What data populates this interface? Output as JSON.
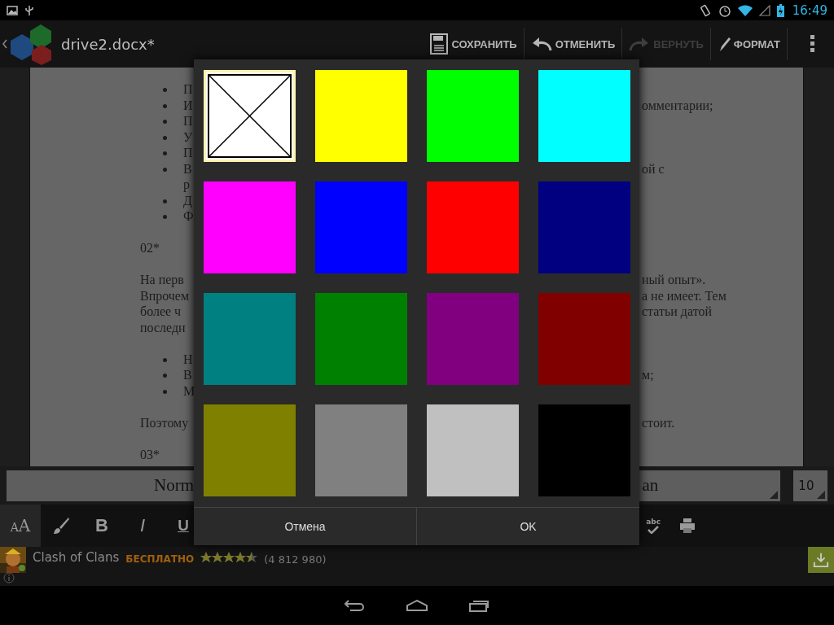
{
  "status_bar": {
    "time": "16:49"
  },
  "action_bar": {
    "title": "drive2.docx*",
    "actions": [
      {
        "kind": "save",
        "label": "СОХРАНИТЬ",
        "disabled": false
      },
      {
        "kind": "undo",
        "label": "ОТМЕНИТЬ",
        "disabled": false
      },
      {
        "kind": "redo",
        "label": "ВЕРНУТЬ",
        "disabled": true
      },
      {
        "kind": "format",
        "label": "ФОРМАТ",
        "disabled": false
      }
    ]
  },
  "document": {
    "blocks": [
      {
        "kind": "list",
        "lines": [
          {
            "bullet": true,
            "left": "П"
          },
          {
            "bullet": true,
            "left": "И",
            "right": "омментарии;"
          },
          {
            "bullet": true,
            "left": "П"
          },
          {
            "bullet": true,
            "left": "У"
          },
          {
            "bullet": true,
            "left": "П"
          },
          {
            "bullet": true,
            "left": "В",
            "right": "ой с"
          },
          {
            "bullet": false,
            "left": "р"
          },
          {
            "bullet": true,
            "left": "Д"
          },
          {
            "bullet": true,
            "left": "Ф"
          }
        ]
      },
      {
        "kind": "para",
        "lines": [
          {
            "left": "02*"
          }
        ]
      },
      {
        "kind": "para",
        "lines": [
          {
            "left": "На перв",
            "right": "ный опыт»."
          },
          {
            "left": "Впрочем",
            "right": "а не имеет. Тем"
          },
          {
            "left": "более ч",
            "right": "статьи датой"
          },
          {
            "left": "последн"
          }
        ]
      },
      {
        "kind": "list",
        "lines": [
          {
            "bullet": true,
            "left": "Н"
          },
          {
            "bullet": true,
            "left": "В",
            "right": "м;"
          },
          {
            "bullet": true,
            "left": "М"
          }
        ]
      },
      {
        "kind": "para",
        "lines": [
          {
            "left": "Поэтому",
            "right": "стоит."
          }
        ]
      },
      {
        "kind": "para",
        "lines": [
          {
            "left": "03*"
          }
        ]
      }
    ]
  },
  "style_bar": {
    "style_field": "Norm",
    "font_field": "an",
    "size_field": "10"
  },
  "toolbar": {
    "left": [
      {
        "kind": "text-size",
        "label": "AA",
        "selected": true
      },
      {
        "kind": "brush",
        "selected": false
      },
      {
        "kind": "glyph",
        "label": "B",
        "selected": false
      },
      {
        "kind": "glyph",
        "label": "I",
        "selected": false
      },
      {
        "kind": "glyph",
        "label": "U",
        "selected": false
      }
    ],
    "right": [
      {
        "kind": "spellcheck",
        "label": "abc",
        "selected": false
      },
      {
        "kind": "print",
        "selected": false
      }
    ]
  },
  "ad_bar": {
    "title": "Clash of Clans",
    "price": "БЕСПЛАТНО",
    "stars": 4.5,
    "rating_count": "(4 812 980)"
  },
  "color_dialog": {
    "swatches": [
      {
        "kind": "none",
        "selected": true
      },
      {
        "kind": "color",
        "color": "#ffff00",
        "selected": false
      },
      {
        "kind": "color",
        "color": "#00ff00",
        "selected": false
      },
      {
        "kind": "color",
        "color": "#00ffff",
        "selected": false
      },
      {
        "kind": "color",
        "color": "#ff00ff",
        "selected": false
      },
      {
        "kind": "color",
        "color": "#0000ff",
        "selected": false
      },
      {
        "kind": "color",
        "color": "#ff0000",
        "selected": false
      },
      {
        "kind": "color",
        "color": "#000080",
        "selected": false
      },
      {
        "kind": "color",
        "color": "#008080",
        "selected": false
      },
      {
        "kind": "color",
        "color": "#008000",
        "selected": false
      },
      {
        "kind": "color",
        "color": "#800080",
        "selected": false
      },
      {
        "kind": "color",
        "color": "#800000",
        "selected": false
      },
      {
        "kind": "color",
        "color": "#808000",
        "selected": false
      },
      {
        "kind": "color",
        "color": "#808080",
        "selected": false
      },
      {
        "kind": "color",
        "color": "#c0c0c0",
        "selected": false
      },
      {
        "kind": "color",
        "color": "#000000",
        "selected": false
      }
    ],
    "buttons": [
      {
        "label": "Отмена"
      },
      {
        "label": "OK"
      }
    ]
  }
}
